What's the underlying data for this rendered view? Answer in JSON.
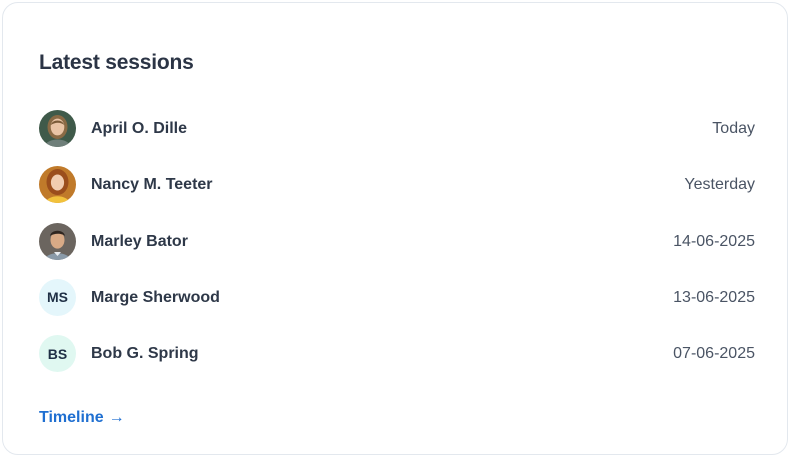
{
  "card": {
    "title": "Latest sessions",
    "sessions": [
      {
        "name": "April O. Dille",
        "date": "Today",
        "avatar": "photo",
        "initials": ""
      },
      {
        "name": "Nancy M. Teeter",
        "date": "Yesterday",
        "avatar": "photo",
        "initials": ""
      },
      {
        "name": "Marley Bator",
        "date": "14-06-2025",
        "avatar": "photo",
        "initials": ""
      },
      {
        "name": "Marge Sherwood",
        "date": "13-06-2025",
        "avatar": "initials",
        "initials": "MS"
      },
      {
        "name": "Bob G. Spring",
        "date": "07-06-2025",
        "avatar": "initials",
        "initials": "BS"
      }
    ],
    "timeline_link": {
      "label": "Timeline",
      "icon": "arrow-right-icon",
      "arrow": "→"
    }
  },
  "colors": {
    "link": "#1f6fd1",
    "title": "#2b3445",
    "border": "#e3e8ee",
    "initials_bg_1": "#e4f6fb",
    "initials_bg_2": "#e0f8f1"
  }
}
